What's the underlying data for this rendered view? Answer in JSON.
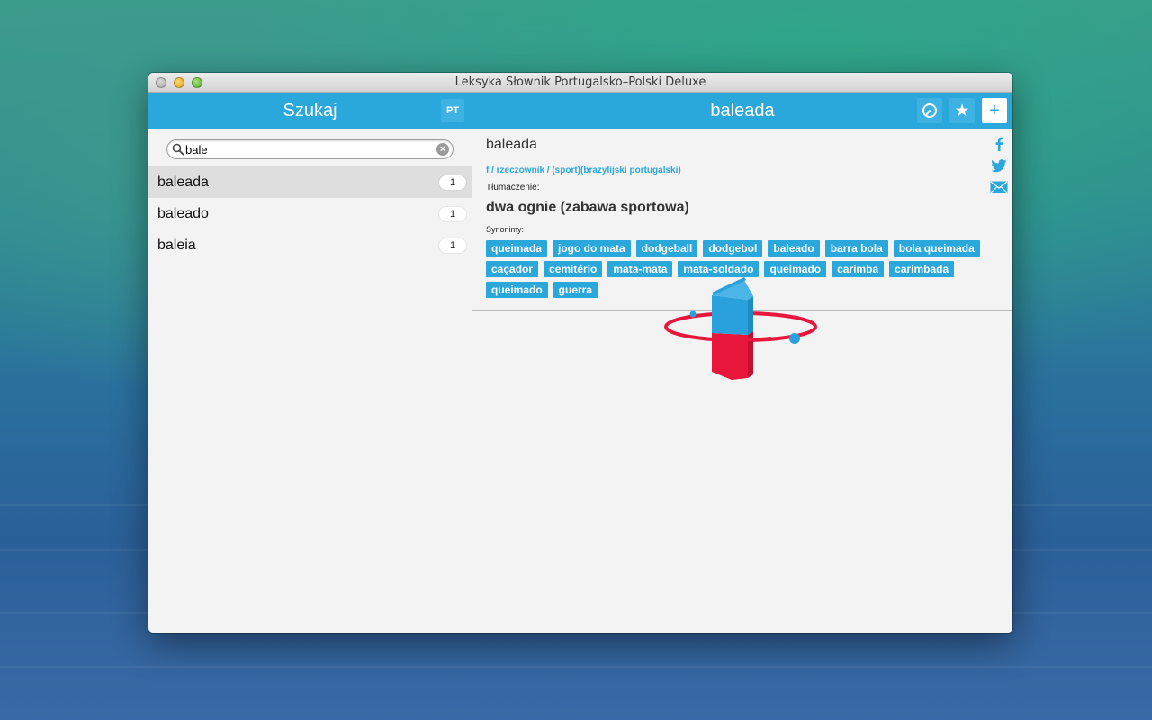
{
  "window": {
    "title": "Leksyka Słownik Portugalsko–Polski Deluxe"
  },
  "left": {
    "title": "Szukaj",
    "lang_button": "PT",
    "search": {
      "value": "bale",
      "placeholder": ""
    },
    "results": [
      {
        "word": "baleada",
        "count": "1",
        "selected": true
      },
      {
        "word": "baleado",
        "count": "1",
        "selected": false
      },
      {
        "word": "baleia",
        "count": "1",
        "selected": false
      }
    ]
  },
  "right": {
    "title": "baleada",
    "icons": {
      "history": "history-icon",
      "favorite": "star-icon",
      "add": "plus-icon"
    },
    "entry": {
      "headword": "baleada",
      "grammar": "f / rzeczownik / (sport)(brazylijski portugalski)",
      "translation_label": "Tłumaczenie:",
      "translation": "dwa ognie (zabawa sportowa)",
      "synonyms_label": "Synonimy:",
      "synonyms": [
        "queimada",
        "jogo do mata",
        "dodgeball",
        "dodgebol",
        "baleado",
        "barra bola",
        "bola queimada",
        "caçador",
        "cemitério",
        "mata-mata",
        "mata-soldado",
        "queimado",
        "carimba",
        "carimbada",
        "queimado",
        "guerra"
      ]
    },
    "share_icons": [
      "facebook-icon",
      "twitter-icon",
      "mail-icon"
    ]
  },
  "colors": {
    "accent": "#2aa7db",
    "logo_red": "#e8163a",
    "logo_blue": "#2aa0dc"
  }
}
